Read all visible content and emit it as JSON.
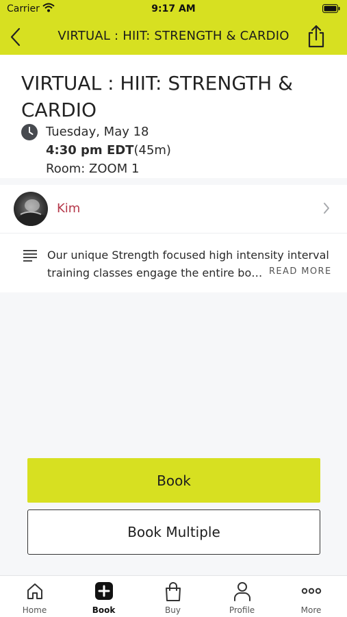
{
  "status_bar": {
    "carrier": "Carrier",
    "time": "9:17 AM"
  },
  "nav": {
    "title": "VIRTUAL : HIIT: STRENGTH & CARDIO"
  },
  "class": {
    "title": "VIRTUAL : HIIT: STRENGTH & CARDIO",
    "date": "Tuesday, May 18",
    "time": "4:30 pm EDT",
    "duration": "(45m)",
    "room": "Room: ZOOM 1"
  },
  "instructor": {
    "name": "Kim"
  },
  "description": {
    "line1": "Our unique Strength focused high intensity interval",
    "line2": "training classes engage the entire bo…",
    "read_more": "READ MORE"
  },
  "actions": {
    "book": "Book",
    "book_multiple": "Book Multiple"
  },
  "tabs": [
    {
      "label": "Home",
      "icon": "home-icon"
    },
    {
      "label": "Book",
      "icon": "plus-square-icon"
    },
    {
      "label": "Buy",
      "icon": "shopping-bag-icon"
    },
    {
      "label": "Profile",
      "icon": "person-icon"
    },
    {
      "label": "More",
      "icon": "more-dots-icon"
    }
  ],
  "colors": {
    "accent": "#d7e021",
    "instructor_link": "#b5384a"
  }
}
